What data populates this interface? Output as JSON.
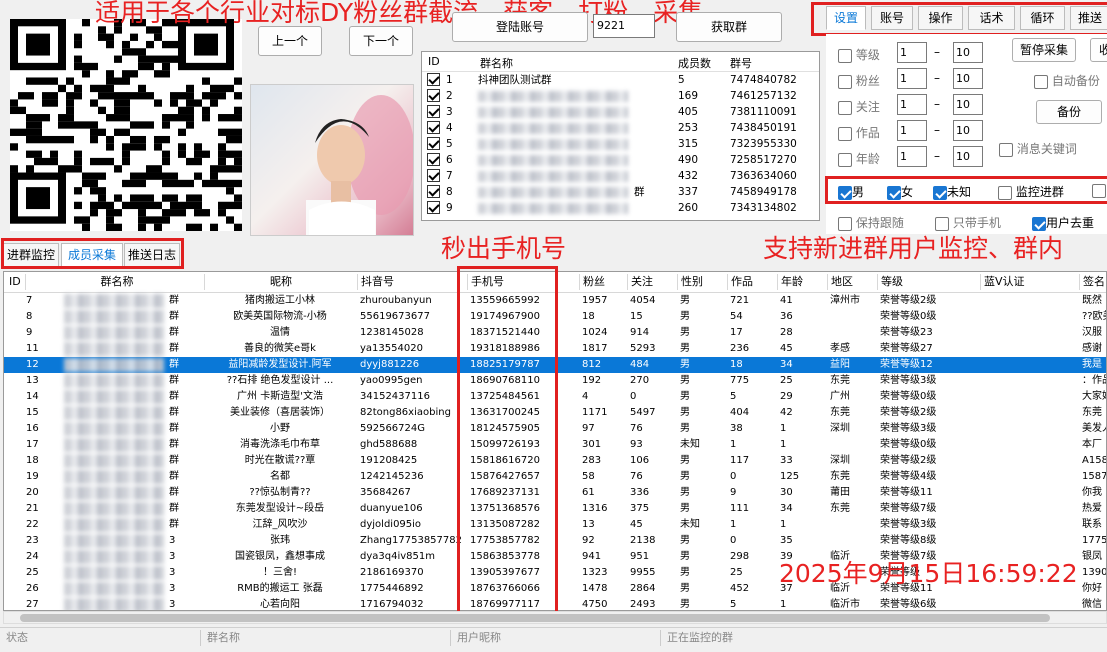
{
  "banner": {
    "top": "适用于各个行业对标DY粉丝群截流、获客、打粉、采集",
    "mid1": "秒出手机号",
    "mid2": "支持新进群用户监控、群内",
    "time": "2025年9月15日16:59:22"
  },
  "buttons": {
    "prev": "上一个",
    "next": "下一个",
    "login": "登陆账号",
    "fetch": "获取群",
    "pause": "暂停采集",
    "backup": "备份",
    "cut": "收"
  },
  "login_value": "9221",
  "group_table": {
    "headers": [
      "ID",
      "群名称",
      "成员数",
      "群号"
    ],
    "rows": [
      {
        "id": "1",
        "name": "抖神团队测试群",
        "count": "5",
        "no": "7474840782"
      },
      {
        "id": "2",
        "name": "",
        "count": "169",
        "no": "7461257132"
      },
      {
        "id": "3",
        "name": "",
        "count": "405",
        "no": "7381110091"
      },
      {
        "id": "4",
        "name": "",
        "count": "253",
        "no": "7438450191"
      },
      {
        "id": "5",
        "name": "",
        "count": "315",
        "no": "7323955330"
      },
      {
        "id": "6",
        "name": "",
        "count": "490",
        "no": "7258517270"
      },
      {
        "id": "7",
        "name": "",
        "count": "432",
        "no": "7363634060"
      },
      {
        "id": "8",
        "name": "群",
        "count": "337",
        "no": "7458949178"
      },
      {
        "id": "9",
        "name": "",
        "count": "260",
        "no": "7343134802"
      }
    ]
  },
  "right_tabs": [
    "设置",
    "账号",
    "操作",
    "话术",
    "循环",
    "推送"
  ],
  "settings": {
    "filters": [
      {
        "label": "等级",
        "from": "1",
        "to": "10"
      },
      {
        "label": "粉丝",
        "from": "1",
        "to": "10"
      },
      {
        "label": "关注",
        "from": "1",
        "to": "10"
      },
      {
        "label": "作品",
        "from": "1",
        "to": "10"
      },
      {
        "label": "年龄",
        "from": "1",
        "to": "10"
      }
    ],
    "dash": "–",
    "auto_backup": "自动备份",
    "msg_keyword": "消息关键词",
    "gender": [
      "男",
      "女",
      "未知"
    ],
    "monitor": "监控进群",
    "follow": "保持跟随",
    "phone_only": "只带手机",
    "dedupe": "用户去重"
  },
  "bottom_tabs": [
    "进群监控",
    "成员采集",
    "推送日志"
  ],
  "member_table": {
    "headers": [
      "ID",
      "群名称",
      "昵称",
      "抖音号",
      "手机号",
      "粉丝",
      "关注",
      "性别",
      "作品",
      "年龄",
      "地区",
      "等级",
      "蓝V认证",
      "签名"
    ],
    "rows": [
      {
        "id": "7",
        "group": "群",
        "nick": "猪肉搬运工小林",
        "dy": "zhuroubanyun",
        "phone": "13559665992",
        "fans": "1957",
        "follow": "4054",
        "sex": "男",
        "works": "721",
        "age": "41",
        "area": "漳州市",
        "level": "荣誉等级2级",
        "sign": "既然"
      },
      {
        "id": "8",
        "group": "群",
        "nick": "欧美英国际物流-小杨",
        "dy": "55619673677",
        "phone": "19174967900",
        "fans": "18",
        "follow": "15",
        "sex": "男",
        "works": "54",
        "age": "36",
        "area": "",
        "level": "荣誉等级0级",
        "sign": "??欧美"
      },
      {
        "id": "9",
        "group": "群",
        "nick": "温情",
        "dy": "1238145028",
        "phone": "18371521440",
        "fans": "1024",
        "follow": "914",
        "sex": "男",
        "works": "17",
        "age": "28",
        "area": "",
        "level": "荣誉等级23",
        "sign": "汉服"
      },
      {
        "id": "11",
        "group": "群",
        "nick": "善良的微笑e哥k",
        "dy": "ya13554020",
        "phone": "19318188986",
        "fans": "1817",
        "follow": "5293",
        "sex": "男",
        "works": "236",
        "age": "45",
        "area": "孝感",
        "level": "荣誉等级27",
        "sign": "感谢"
      },
      {
        "id": "12",
        "group": "群",
        "nick": "益阳减龄发型设计.阿军",
        "dy": "dyyj881226",
        "phone": "18825179787",
        "fans": "812",
        "follow": "484",
        "sex": "男",
        "works": "18",
        "age": "34",
        "area": "益阳",
        "level": "荣誉等级12",
        "sign": "我是"
      },
      {
        "id": "13",
        "group": "群",
        "nick": "??石排 绝色发型设计 ...",
        "dy": "yao0995gen",
        "phone": "18690768110",
        "fans": "192",
        "follow": "270",
        "sex": "男",
        "works": "775",
        "age": "25",
        "area": "东莞",
        "level": "荣誉等级3级",
        "sign": "：作品"
      },
      {
        "id": "14",
        "group": "群",
        "nick": "广州 卡斯造型'文浩",
        "dy": "34152437116",
        "phone": "13725484561",
        "fans": "4",
        "follow": "0",
        "sex": "男",
        "works": "5",
        "age": "29",
        "area": "广州",
        "level": "荣誉等级0级",
        "sign": "大家好"
      },
      {
        "id": "15",
        "group": "群",
        "nick": "美业装修（喜居装饰）",
        "dy": "82tong86xiaobing",
        "phone": "13631700245",
        "fans": "1171",
        "follow": "5497",
        "sex": "男",
        "works": "404",
        "age": "42",
        "area": "东莞",
        "level": "荣誉等级2级",
        "sign": "东莞"
      },
      {
        "id": "16",
        "group": "群",
        "nick": "小野",
        "dy": "592566724G",
        "phone": "18124575905",
        "fans": "97",
        "follow": "76",
        "sex": "男",
        "works": "38",
        "age": "1",
        "area": "深圳",
        "level": "荣誉等级3级",
        "sign": "美发人"
      },
      {
        "id": "17",
        "group": "群",
        "nick": "消毒洗涤毛巾布草",
        "dy": "ghd588688",
        "phone": "15099726193",
        "fans": "301",
        "follow": "93",
        "sex": "未知",
        "works": "1",
        "age": "1",
        "area": "",
        "level": "荣誉等级0级",
        "sign": "本厂"
      },
      {
        "id": "18",
        "group": "群",
        "nick": "时光在散谎??覃",
        "dy": "191208425",
        "phone": "15818616720",
        "fans": "283",
        "follow": "106",
        "sex": "男",
        "works": "117",
        "age": "33",
        "area": "深圳",
        "level": "荣誉等级2级",
        "sign": "A158"
      },
      {
        "id": "19",
        "group": "群",
        "nick": "名都",
        "dy": "1242145236",
        "phone": "15876427657",
        "fans": "58",
        "follow": "76",
        "sex": "男",
        "works": "0",
        "age": "125",
        "area": "东莞",
        "level": "荣誉等级4级",
        "sign": "1587"
      },
      {
        "id": "20",
        "group": "群",
        "nick": "??惊弘制青??",
        "dy": "35684267",
        "phone": "17689237131",
        "fans": "61",
        "follow": "336",
        "sex": "男",
        "works": "9",
        "age": "30",
        "area": "莆田",
        "level": "荣誉等级11",
        "sign": "你我"
      },
      {
        "id": "21",
        "group": "群",
        "nick": "东莞发型设计~段岳",
        "dy": "duanyue106",
        "phone": "13751368576",
        "fans": "1316",
        "follow": "375",
        "sex": "男",
        "works": "111",
        "age": "34",
        "area": "东莞",
        "level": "荣誉等级7级",
        "sign": "热爱"
      },
      {
        "id": "22",
        "group": "群",
        "nick": "江辞_风吹沙",
        "dy": "dyjoldi095io",
        "phone": "13135087282",
        "fans": "13",
        "follow": "45",
        "sex": "未知",
        "works": "1",
        "age": "1",
        "area": "",
        "level": "荣誉等级3级",
        "sign": "联系"
      },
      {
        "id": "23",
        "group": "3",
        "nick": "张玮",
        "dy": "Zhang17753857782",
        "phone": "17753857782",
        "fans": "92",
        "follow": "2138",
        "sex": "男",
        "works": "0",
        "age": "35",
        "area": "",
        "level": "荣誉等级8级",
        "sign": "1775"
      },
      {
        "id": "24",
        "group": "3",
        "nick": "国瓷银凤，鑫想事成",
        "dy": "dya3q4iv851m",
        "phone": "15863853778",
        "fans": "941",
        "follow": "951",
        "sex": "男",
        "works": "298",
        "age": "39",
        "area": "临沂",
        "level": "荣誉等级7级",
        "sign": "银凤"
      },
      {
        "id": "25",
        "group": "3",
        "nick": "！三舍!",
        "dy": "2186169370",
        "phone": "13905397677",
        "fans": "1323",
        "follow": "9955",
        "sex": "男",
        "works": "25",
        "age": "",
        "area": "",
        "level": "荣誉等级",
        "sign": "1390"
      },
      {
        "id": "26",
        "group": "3",
        "nick": "RMB的搬运工 张磊",
        "dy": "1775446892",
        "phone": "18763766066",
        "fans": "1478",
        "follow": "2864",
        "sex": "男",
        "works": "452",
        "age": "37",
        "area": "临沂",
        "level": "荣誉等级11",
        "sign": "你好"
      },
      {
        "id": "27",
        "group": "3",
        "nick": "心若向阳",
        "dy": "1716794032",
        "phone": "18769977117",
        "fans": "4750",
        "follow": "2493",
        "sex": "男",
        "works": "5",
        "age": "1",
        "area": "临沂市",
        "level": "荣誉等级6级",
        "sign": "微信"
      }
    ]
  },
  "status_bar": [
    "状态",
    "群名称",
    "用户昵称",
    "正在监控的群"
  ],
  "colors": {
    "accent": "#0a78d7",
    "red": "#e02020",
    "checkbox": "#1976d2"
  }
}
